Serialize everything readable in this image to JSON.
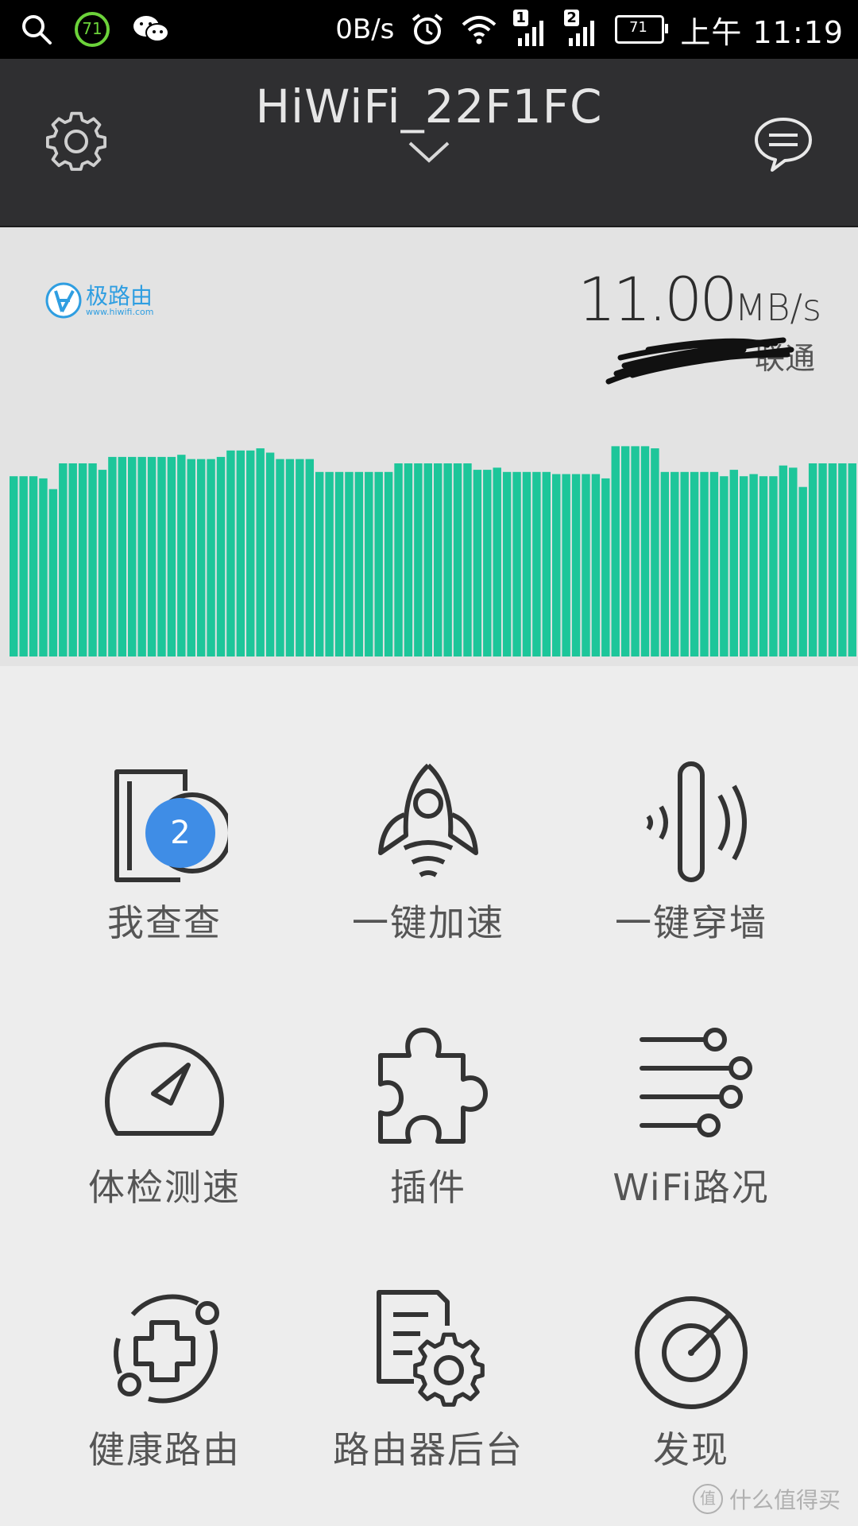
{
  "status_bar": {
    "battery_ring": "71",
    "net_speed": "0B/s",
    "sim1": "1",
    "sim2": "2",
    "battery": "71",
    "time": "上午 11:19"
  },
  "header": {
    "router_name": "HiWiFi_22F1FC"
  },
  "speed": {
    "brand_name": "极路由",
    "brand_url": "www.hiwifi.com",
    "value": "11.00",
    "unit": "MB/s",
    "isp": "联通",
    "bar_levels": [
      0.84,
      0.84,
      0.84,
      0.83,
      0.78,
      0.9,
      0.9,
      0.9,
      0.9,
      0.87,
      0.93,
      0.93,
      0.93,
      0.93,
      0.93,
      0.93,
      0.93,
      0.94,
      0.92,
      0.92,
      0.92,
      0.93,
      0.96,
      0.96,
      0.96,
      0.97,
      0.95,
      0.92,
      0.92,
      0.92,
      0.92,
      0.86,
      0.86,
      0.86,
      0.86,
      0.86,
      0.86,
      0.86,
      0.86,
      0.9,
      0.9,
      0.9,
      0.9,
      0.9,
      0.9,
      0.9,
      0.9,
      0.87,
      0.87,
      0.88,
      0.86,
      0.86,
      0.86,
      0.86,
      0.86,
      0.85,
      0.85,
      0.85,
      0.85,
      0.85,
      0.83,
      0.98,
      0.98,
      0.98,
      0.98,
      0.97,
      0.86,
      0.86,
      0.86,
      0.86,
      0.86,
      0.86,
      0.84,
      0.87,
      0.84,
      0.85,
      0.84,
      0.84,
      0.89,
      0.88,
      0.79,
      0.9,
      0.9,
      0.9,
      0.9,
      0.9
    ]
  },
  "menu": {
    "items": [
      {
        "label": "我查查",
        "icon": "phone-scan-icon",
        "badge": "2"
      },
      {
        "label": "一键加速",
        "icon": "rocket-icon"
      },
      {
        "label": "一键穿墙",
        "icon": "wall-signal-icon"
      },
      {
        "label": "体检测速",
        "icon": "speedometer-icon"
      },
      {
        "label": "插件",
        "icon": "puzzle-icon"
      },
      {
        "label": "WiFi路况",
        "icon": "wifi-traffic-icon"
      },
      {
        "label": "健康路由",
        "icon": "health-cross-icon"
      },
      {
        "label": "路由器后台",
        "icon": "doc-gear-icon"
      },
      {
        "label": "发现",
        "icon": "radar-icon"
      }
    ]
  },
  "watermark": {
    "icon": "值",
    "text": "什么值得买"
  },
  "colors": {
    "accent_green": "#1dc69a",
    "badge_blue": "#3f8de6",
    "topbar": "#2f2f31"
  }
}
